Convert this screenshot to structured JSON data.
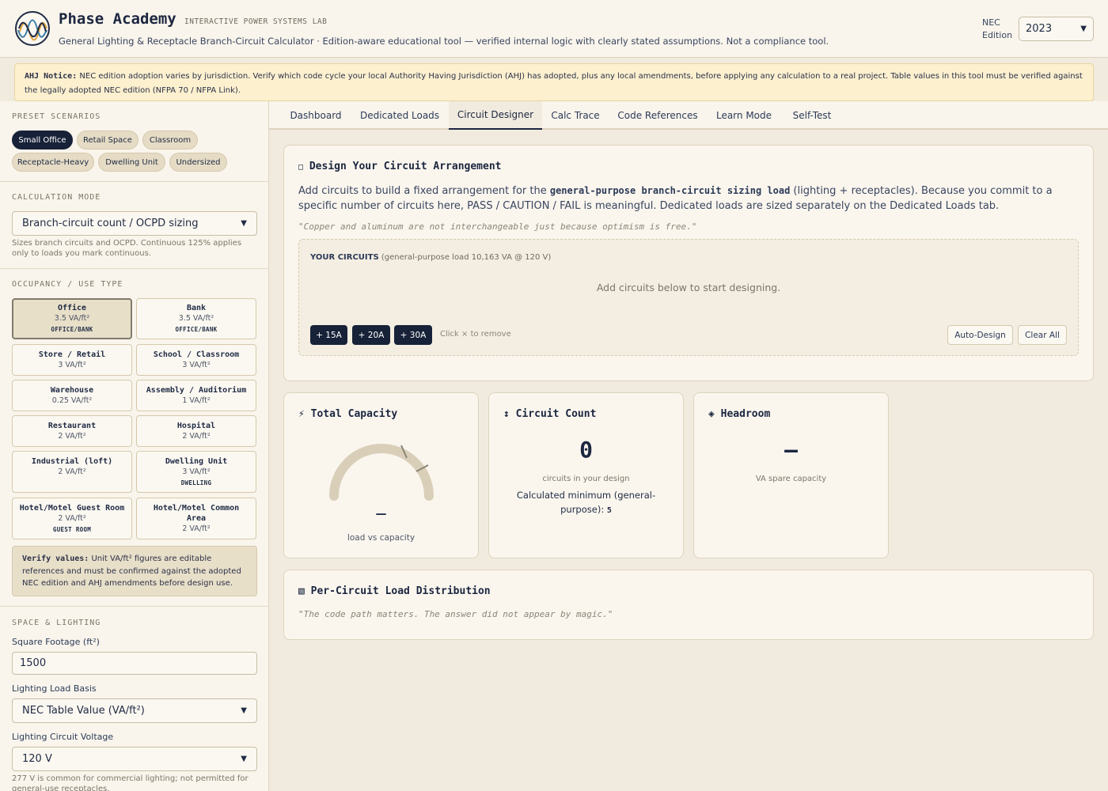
{
  "header": {
    "brand": "Phase Academy",
    "tagline": "INTERACTIVE POWER SYSTEMS LAB",
    "subtitle": "General Lighting & Receptacle Branch-Circuit Calculator · Edition-aware educational tool — verified internal logic with clearly stated assumptions. Not a compliance tool.",
    "nec_label_1": "NEC",
    "nec_label_2": "Edition",
    "nec_value": "2023"
  },
  "notice": {
    "title": "AHJ Notice:",
    "text": "NEC edition adoption varies by jurisdiction. Verify which code cycle your local Authority Having Jurisdiction (AHJ) has adopted, plus any local amendments, before applying any calculation to a real project. Table values in this tool must be verified against the legally adopted NEC edition (NFPA 70 / NFPA Link)."
  },
  "sidebar": {
    "presets_title": "PRESET SCENARIOS",
    "presets": [
      "Small Office",
      "Retail Space",
      "Classroom",
      "Receptacle-Heavy",
      "Dwelling Unit",
      "Undersized"
    ],
    "calc_mode_title": "CALCULATION MODE",
    "calc_mode_value": "Branch-circuit count / OCPD sizing",
    "calc_mode_help": "Sizes branch circuits and OCPD. Continuous 125% applies only to loads you mark continuous.",
    "occupancy_title": "OCCUPANCY / USE TYPE",
    "occupancies": [
      {
        "name": "Office",
        "value": "3.5 VA/ft²",
        "sub": "OFFICE/BANK"
      },
      {
        "name": "Bank",
        "value": "3.5 VA/ft²",
        "sub": "OFFICE/BANK"
      },
      {
        "name": "Store / Retail",
        "value": "3 VA/ft²",
        "sub": ""
      },
      {
        "name": "School / Classroom",
        "value": "3 VA/ft²",
        "sub": ""
      },
      {
        "name": "Warehouse",
        "value": "0.25 VA/ft²",
        "sub": ""
      },
      {
        "name": "Assembly / Auditorium",
        "value": "1 VA/ft²",
        "sub": ""
      },
      {
        "name": "Restaurant",
        "value": "2 VA/ft²",
        "sub": ""
      },
      {
        "name": "Hospital",
        "value": "2 VA/ft²",
        "sub": ""
      },
      {
        "name": "Industrial (loft)",
        "value": "2 VA/ft²",
        "sub": ""
      },
      {
        "name": "Dwelling Unit",
        "value": "3 VA/ft²",
        "sub": "DWELLING"
      },
      {
        "name": "Hotel/Motel Guest Room",
        "value": "2 VA/ft²",
        "sub": "GUEST ROOM"
      },
      {
        "name": "Hotel/Motel Common Area",
        "value": "2 VA/ft²",
        "sub": ""
      }
    ],
    "verify_title": "Verify values:",
    "verify_text": "Unit VA/ft² figures are editable references and must be confirmed against the adopted NEC edition and AHJ amendments before design use.",
    "space_title": "SPACE & LIGHTING",
    "sqft_label": "Square Footage (ft²)",
    "sqft_value": "1500",
    "lighting_basis_label": "Lighting Load Basis",
    "lighting_basis_value": "NEC Table Value (VA/ft²)",
    "voltage_label": "Lighting Circuit Voltage",
    "voltage_value": "120 V",
    "voltage_help": "277 V is common for commercial lighting; not permitted for general-use receptacles."
  },
  "tabs": [
    "Dashboard",
    "Dedicated Loads",
    "Circuit Designer",
    "Calc Trace",
    "Code References",
    "Learn Mode",
    "Self-Test"
  ],
  "active_tab": "Circuit Designer",
  "designer": {
    "title": "Design Your Circuit Arrangement",
    "text_1": "Add circuits to build a fixed arrangement for the ",
    "text_code": "general-purpose branch-circuit sizing load",
    "text_2": " (lighting + receptacles). Because you commit to a specific number of circuits here, PASS / CAUTION / FAIL is meaningful. Dedicated loads are sized separately on the Dedicated Loads tab.",
    "quote": "\"Copper and aluminum are not interchangeable just because optimism is free.\"",
    "your_circuits_label": "YOUR CIRCUITS",
    "your_circuits_detail": "(general-purpose load 10,163 VA @ 120 V)",
    "empty_message": "Add circuits below to start designing.",
    "add_buttons": [
      "+ 15A",
      "+ 20A",
      "+ 30A"
    ],
    "hint": "Click × to remove",
    "auto_design": "Auto-Design",
    "clear_all": "Clear All"
  },
  "metrics": {
    "capacity": {
      "icon": "⚡",
      "title": "Total Capacity",
      "value": "—",
      "caption": "load vs capacity"
    },
    "count": {
      "icon": "↕",
      "title": "Circuit Count",
      "value": "0",
      "caption": "circuits in your design",
      "min_text": "Calculated minimum (general-purpose):",
      "min_value": "5"
    },
    "headroom": {
      "icon": "◈",
      "title": "Headroom",
      "value": "—",
      "caption": "VA spare capacity"
    }
  },
  "distribution": {
    "icon": "▧",
    "title": "Per-Circuit Load Distribution",
    "quote": "\"The code path matters. The answer did not appear by magic.\""
  },
  "colors": {
    "navy": "#172238",
    "cream": "#f9f5ec",
    "sand": "#e6dcc5",
    "gauge_track": "#d9cfb9"
  }
}
